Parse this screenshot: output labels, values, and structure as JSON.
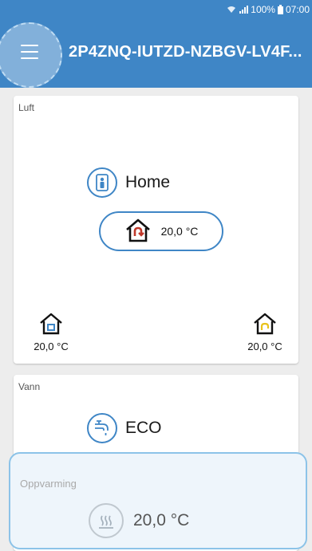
{
  "status_bar": {
    "battery": "100%",
    "time": "07:00"
  },
  "app_bar": {
    "title": "2P4ZNQ-IUTZD-NZBGV-LV4F..."
  },
  "air_card": {
    "label": "Luft",
    "mode": "Home",
    "main_temp": "20,0 °C",
    "left_zone_temp": "20,0 °C",
    "right_zone_temp": "20,0 °C"
  },
  "water_card": {
    "label": "Vann",
    "mode": "ECO",
    "heating_label": "Oppvarming",
    "heating_temp": "20,0 °C"
  },
  "colors": {
    "primary": "#3f86c6",
    "accent_red": "#c0392b",
    "accent_yellow": "#e8c21a"
  }
}
